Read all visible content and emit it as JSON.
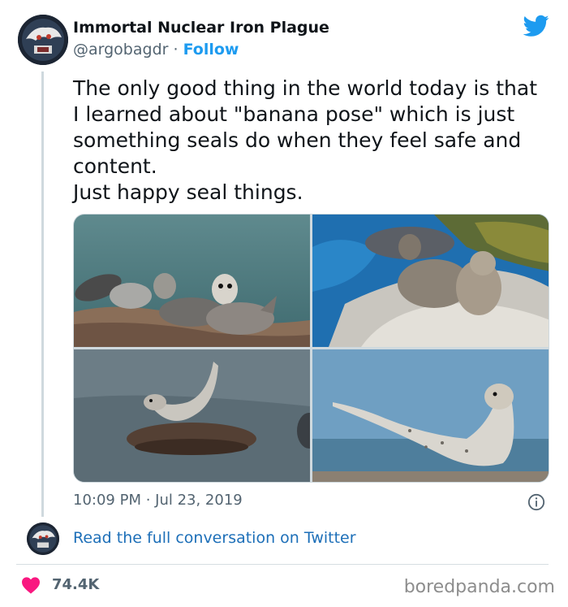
{
  "author": {
    "display_name": "Immortal Nuclear Iron Plague",
    "handle": "@argobagdr",
    "separator": "·",
    "follow_label": "Follow"
  },
  "tweet": {
    "lines": [
      "The only good thing in the world today is that",
      "I learned about \"banana pose\" which is just",
      "something seals do when they feel safe and",
      "content.",
      "Just happy seal things."
    ],
    "timestamp": "10:09 PM · Jul 23, 2019"
  },
  "media": {
    "photos": [
      "seal-photo-group",
      "seal-photo-rock-blue-water",
      "seal-photo-rock-curved",
      "seal-photo-beach-banana"
    ]
  },
  "conversation_link": "Read the full conversation on Twitter",
  "likes": "74.4K",
  "watermark": "boredpanda.com",
  "colors": {
    "twitter_blue": "#1d9bf0",
    "link_blue": "#1d6fb8",
    "heart_pink": "#f91880",
    "secondary_text": "#536471"
  },
  "icons": {
    "brand": "twitter-bird-icon",
    "info": "info-icon",
    "like": "heart-icon"
  }
}
